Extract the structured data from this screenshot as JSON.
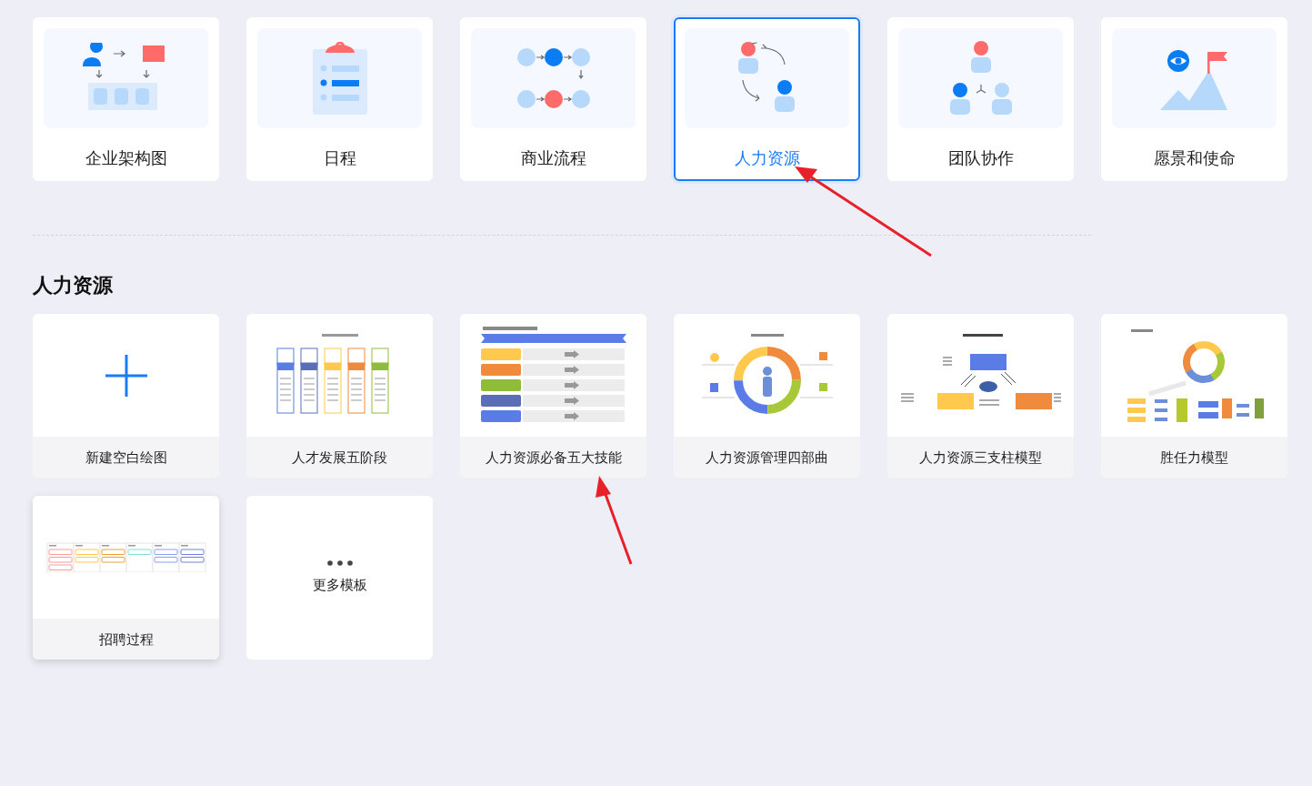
{
  "categories": [
    {
      "label": "企业架构图",
      "kind": "org",
      "selected": false
    },
    {
      "label": "日程",
      "kind": "schedule",
      "selected": false
    },
    {
      "label": "商业流程",
      "kind": "flow",
      "selected": false
    },
    {
      "label": "人力资源",
      "kind": "hr",
      "selected": true
    },
    {
      "label": "团队协作",
      "kind": "team",
      "selected": false
    },
    {
      "label": "愿景和使命",
      "kind": "vision",
      "selected": false
    }
  ],
  "section_title": "人力资源",
  "templates": [
    {
      "label": "新建空白绘图",
      "kind": "blank",
      "hovered": false
    },
    {
      "label": "人才发展五阶段",
      "kind": "stages",
      "hovered": false
    },
    {
      "label": "人力资源必备五大技能",
      "kind": "skills",
      "hovered": false
    },
    {
      "label": "人力资源管理四部曲",
      "kind": "fourstep",
      "hovered": false
    },
    {
      "label": "人力资源三支柱模型",
      "kind": "pillars",
      "hovered": false
    },
    {
      "label": "胜任力模型",
      "kind": "competency",
      "hovered": false
    },
    {
      "label": "招聘过程",
      "kind": "recruit",
      "hovered": true
    },
    {
      "label": "更多模板",
      "kind": "more",
      "hovered": false
    }
  ]
}
